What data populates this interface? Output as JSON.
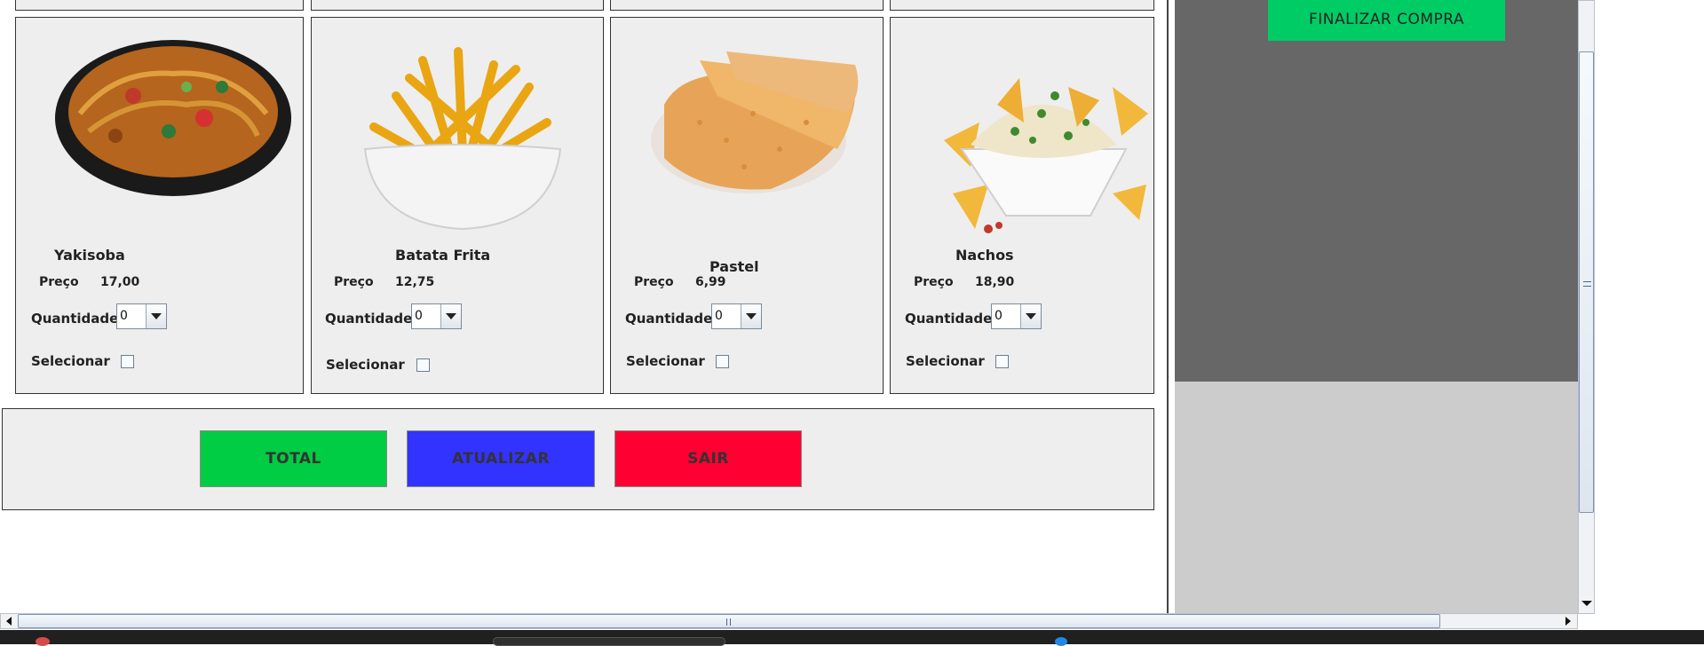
{
  "window_action": {
    "finalize_label": "FINALIZAR COMPRA"
  },
  "products": [
    {
      "name": "Yakisoba",
      "price_label": "Preço",
      "price": "17,00",
      "quantity_label": "Quantidade",
      "quantity": "0",
      "select_label": "Selecionar"
    },
    {
      "name": "Batata Frita",
      "price_label": "Preço",
      "price": "12,75",
      "quantity_label": "Quantidade",
      "quantity": "0",
      "select_label": "Selecionar"
    },
    {
      "name": "Pastel",
      "price_label": "Preço",
      "price": "6,99",
      "quantity_label": "Quantidade",
      "quantity": "0",
      "select_label": "Selecionar"
    },
    {
      "name": "Nachos",
      "price_label": "Preço",
      "price": "18,90",
      "quantity_label": "Quantidade",
      "quantity": "0",
      "select_label": "Selecionar"
    }
  ],
  "actions": {
    "total_label": "TOTAL",
    "update_label": "ATUALIZAR",
    "exit_label": "SAIR"
  },
  "colors": {
    "total": "#00cc44",
    "update": "#3333ff",
    "exit": "#ff0033",
    "finalize": "#00cc66"
  },
  "icons": [
    "yakisoba-image",
    "fries-image",
    "pastel-image",
    "nachos-image",
    "scroll-left-icon",
    "scroll-right-icon",
    "scroll-down-icon"
  ]
}
